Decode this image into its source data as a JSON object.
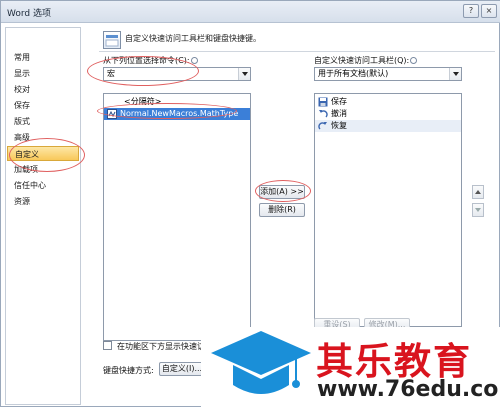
{
  "window": {
    "title": "Word 选项",
    "help_label": "?",
    "close_label": "×"
  },
  "sidebar": {
    "items": [
      {
        "label": "常用"
      },
      {
        "label": "显示"
      },
      {
        "label": "校对"
      },
      {
        "label": "保存"
      },
      {
        "label": "版式"
      },
      {
        "label": "高级"
      },
      {
        "label": "自定义",
        "selected": true
      },
      {
        "label": "加载项"
      },
      {
        "label": "信任中心"
      },
      {
        "label": "资源"
      }
    ]
  },
  "main": {
    "header": "自定义快速访问工具栏和键盘快捷键。",
    "choose_commands_label": "从下列位置选择命令(C):",
    "choose_commands_value": "宏",
    "customize_toolbar_label": "自定义快速访问工具栏(Q):",
    "customize_toolbar_value": "用于所有文档(默认)",
    "command_list": [
      {
        "label": "<分隔符>",
        "icon": "separator-icon"
      },
      {
        "label": "Normal.NewMacros.MathType",
        "icon": "macro-icon",
        "selected": true
      }
    ],
    "toolbar_list": [
      {
        "label": "保存",
        "icon": "save-icon"
      },
      {
        "label": "撤消",
        "icon": "undo-icon"
      },
      {
        "label": "恢复",
        "icon": "redo-icon"
      }
    ],
    "add_button": "添加(A) >>",
    "remove_button": "删除(R)",
    "reset_button": "重设(S)",
    "modify_button": "修改(M)...",
    "show_below_ribbon_label": "在功能区下方显示快速访问",
    "keyboard_shortcuts_label": "键盘快捷方式:",
    "customize_button": "自定义(I)..."
  },
  "watermark": {
    "title": "其乐教育",
    "url": "www.76edu.com"
  },
  "colors": {
    "selection_highlight": "#f8c85a",
    "list_selection": "#3b7fd8",
    "annotation_ring": "#e06060",
    "watermark_red": "#d9141e",
    "watermark_blue": "#1a8fd8"
  }
}
